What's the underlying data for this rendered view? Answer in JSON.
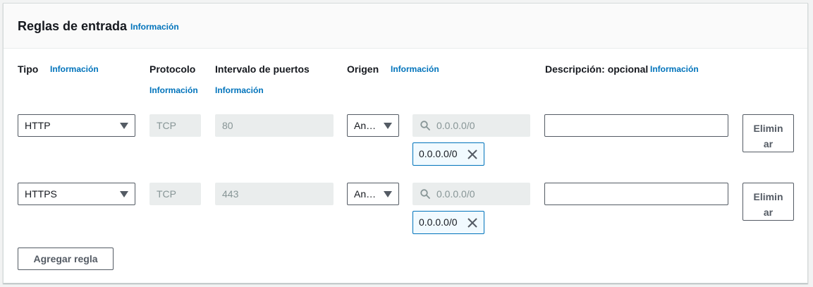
{
  "header": {
    "title": "Reglas de entrada",
    "info": "Información"
  },
  "columns": {
    "tipo": "Tipo",
    "protocolo": "Protocolo",
    "puertos": "Intervalo de puertos",
    "origen": "Origen",
    "descripcion": "Descripción: opcional",
    "info": "Información"
  },
  "rules": [
    {
      "tipo": "HTTP",
      "protocolo": "TCP",
      "puertos": "80",
      "origen": "An…",
      "cidr_placeholder": "0.0.0.0/0",
      "token": "0.0.0.0/0",
      "descripcion": "",
      "remove_label": "Eliminar"
    },
    {
      "tipo": "HTTPS",
      "protocolo": "TCP",
      "puertos": "443",
      "origen": "An…",
      "cidr_placeholder": "0.0.0.0/0",
      "token": "0.0.0.0/0",
      "descripcion": "",
      "remove_label": "Eliminar"
    }
  ],
  "add_rule_label": "Agregar regla",
  "colors": {
    "link": "#0073bb",
    "border": "#545b64",
    "readonly_bg": "#eaeded",
    "token_border": "#0073bb"
  }
}
